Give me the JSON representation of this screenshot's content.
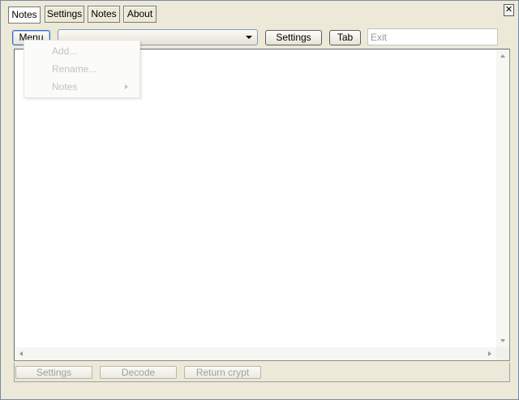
{
  "window": {
    "close_symbol": "✕"
  },
  "tabs": [
    {
      "label": "Notes",
      "active": true
    },
    {
      "label": "Settings",
      "active": false
    },
    {
      "label": "Notes",
      "active": false
    },
    {
      "label": "About",
      "active": false
    }
  ],
  "toolbar": {
    "menu_label": "Menu",
    "combo_value": "",
    "settings_label": "Settings",
    "tab_label": "Tab",
    "exit_placeholder": "Exit"
  },
  "menu_dropdown": {
    "items": [
      {
        "label": "Add...",
        "enabled": false
      },
      {
        "label": "Rename...",
        "enabled": false
      },
      {
        "label": "Notes",
        "enabled": false,
        "has_submenu": true
      }
    ]
  },
  "editor": {
    "content": ""
  },
  "bottom_bar": {
    "settings_label": "Settings",
    "decode_label": "Decode",
    "return_crypt_label": "Return crypt"
  }
}
